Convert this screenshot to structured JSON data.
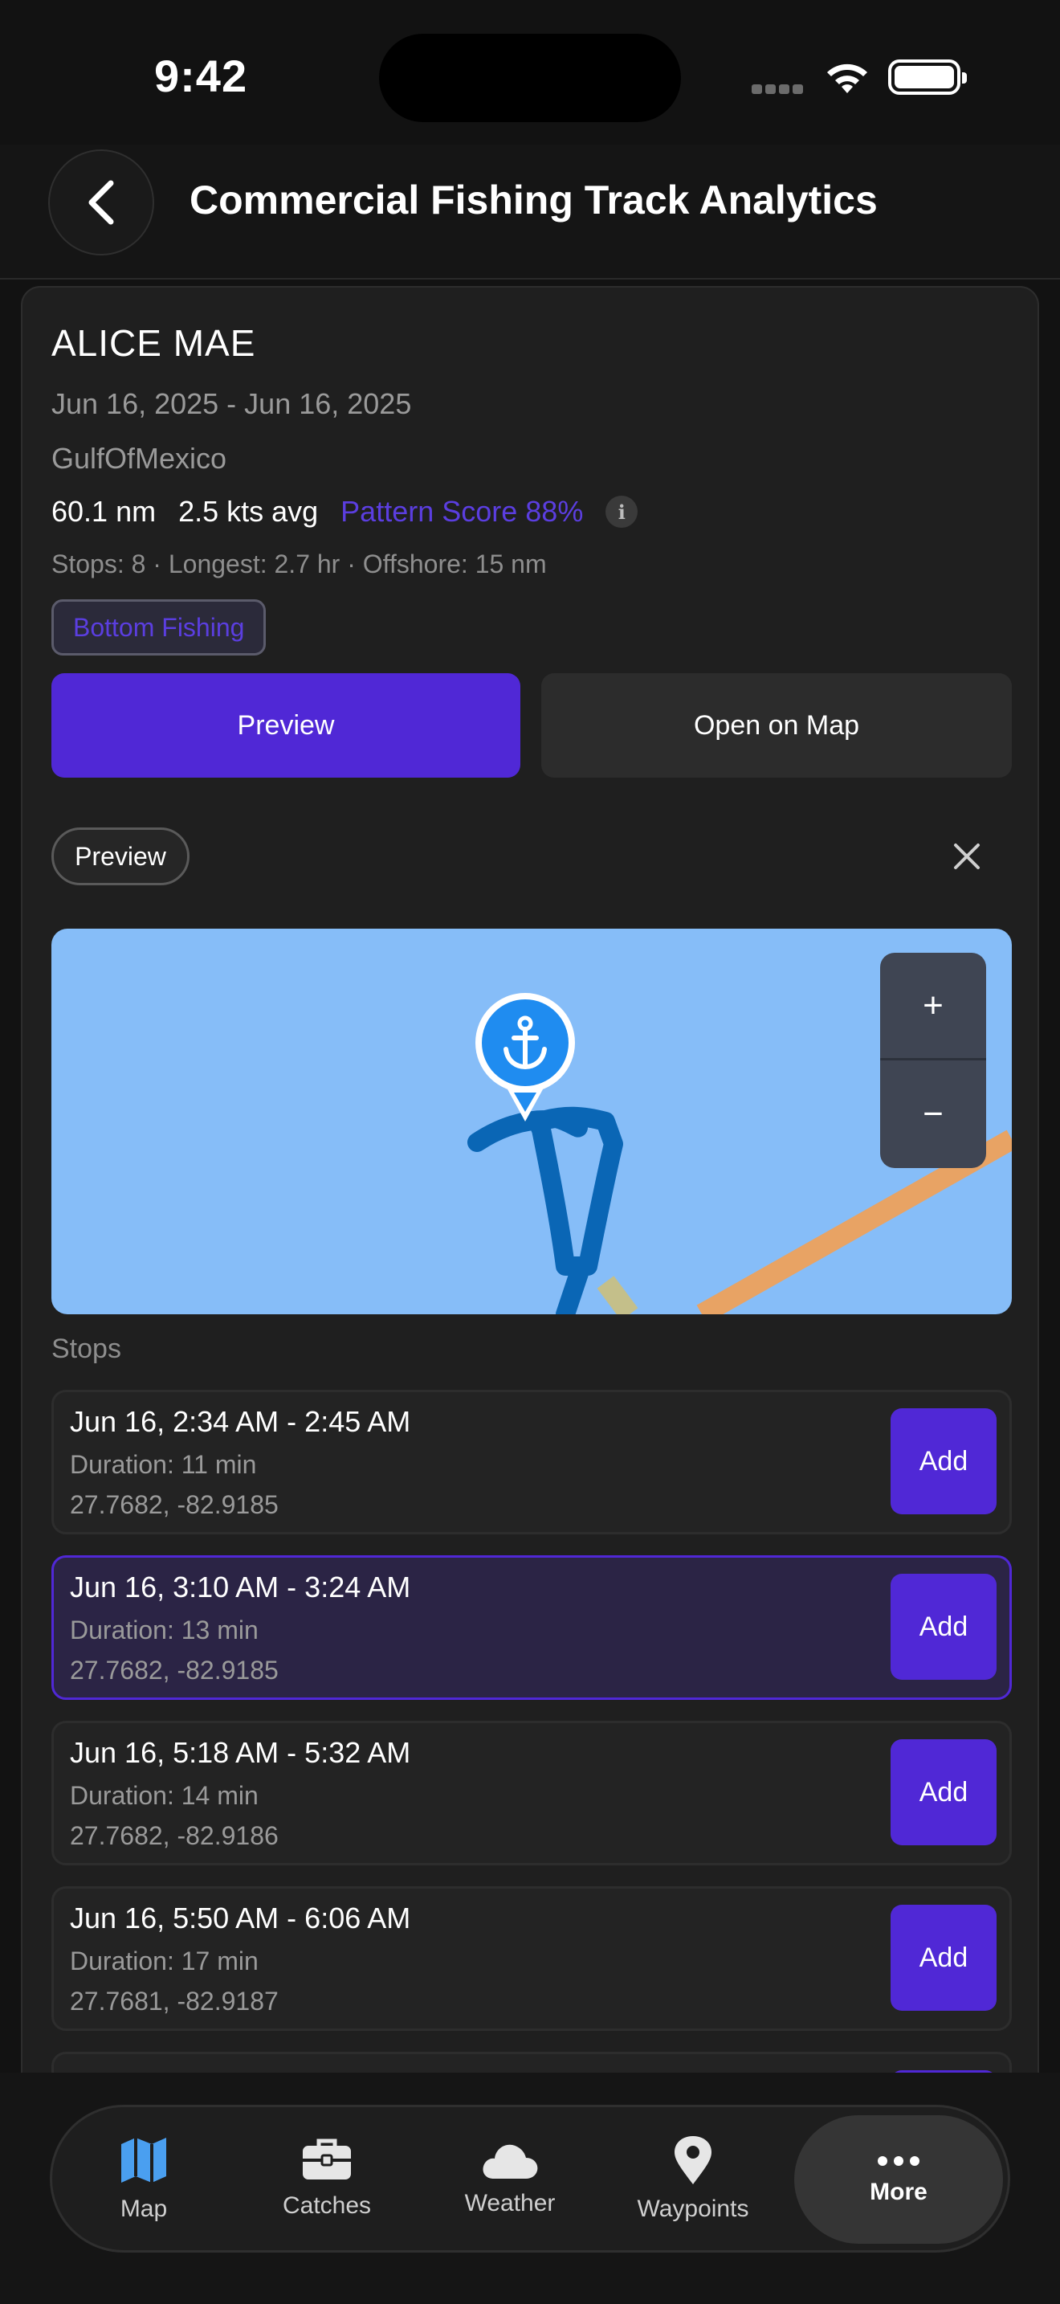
{
  "status": {
    "time": "9:42"
  },
  "header": {
    "title": "Commercial Fishing Track Analytics"
  },
  "trip": {
    "vessel": "ALICE MAE",
    "dates": "Jun 16, 2025 - Jun 16, 2025",
    "region": "GulfOfMexico",
    "distance": "60.1 nm",
    "speed": "2.5 kts avg",
    "pattern_score": "Pattern Score 88%",
    "summary": "Stops: 8 · Longest: 2.7 hr · Offshore: 15 nm",
    "tag": "Bottom Fishing"
  },
  "actions": {
    "preview_label": "Preview",
    "open_map_label": "Open on Map"
  },
  "preview_panel": {
    "chip_label": "Preview",
    "zoom_in": "+",
    "zoom_out": "−"
  },
  "colors": {
    "accent": "#5028d6",
    "map_water": "#86bdf8",
    "track": "#0a66b5",
    "road": "#e8a364",
    "pin": "#1f8cf0"
  },
  "stops": {
    "label": "Stops",
    "items": [
      {
        "time": "Jun 16, 2:34 AM - 2:45 AM",
        "duration": "Duration: 11 min",
        "coords": "27.7682, -82.9185",
        "add": "Add",
        "selected": false
      },
      {
        "time": "Jun 16, 3:10 AM - 3:24 AM",
        "duration": "Duration: 13 min",
        "coords": "27.7682, -82.9185",
        "add": "Add",
        "selected": true
      },
      {
        "time": "Jun 16, 5:18 AM - 5:32 AM",
        "duration": "Duration: 14 min",
        "coords": "27.7682, -82.9186",
        "add": "Add",
        "selected": false
      },
      {
        "time": "Jun 16, 5:50 AM - 6:06 AM",
        "duration": "Duration: 17 min",
        "coords": "27.7681, -82.9187",
        "add": "Add",
        "selected": false
      }
    ]
  },
  "tabbar": {
    "items": [
      {
        "label": "Map",
        "icon": "map-icon"
      },
      {
        "label": "Catches",
        "icon": "briefcase-icon"
      },
      {
        "label": "Weather",
        "icon": "cloud-icon"
      },
      {
        "label": "Waypoints",
        "icon": "pin-icon"
      },
      {
        "label": "More",
        "icon": "more-icon"
      }
    ]
  }
}
